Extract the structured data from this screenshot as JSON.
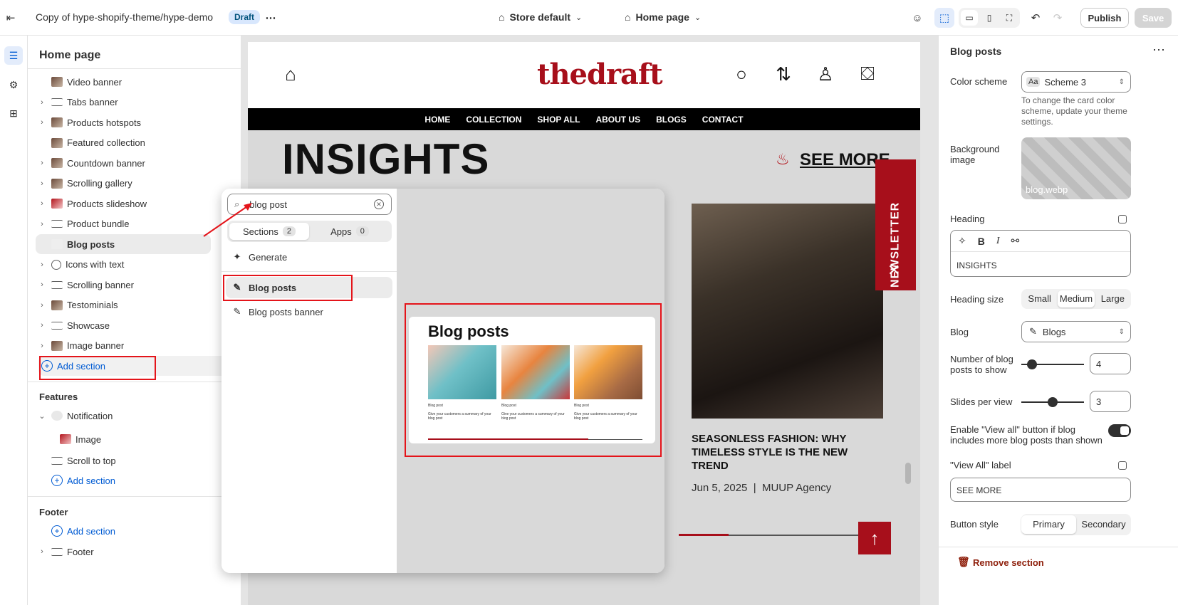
{
  "topbar": {
    "theme_name": "Copy of hype-shopify-theme/hype-demo",
    "status_badge": "Draft",
    "store_selector": "Store default",
    "page_selector": "Home page",
    "publish_label": "Publish",
    "save_label": "Save"
  },
  "left_panel": {
    "title": "Home page",
    "template_items": [
      {
        "label": "Video banner",
        "expandable": false,
        "icon": "image-thumb"
      },
      {
        "label": "Tabs banner",
        "expandable": true,
        "icon": "section-icon"
      },
      {
        "label": "Products hotspots",
        "expandable": true,
        "icon": "image-thumb"
      },
      {
        "label": "Featured collection",
        "expandable": false,
        "icon": "image-thumb"
      },
      {
        "label": "Countdown banner",
        "expandable": true,
        "icon": "image-thumb"
      },
      {
        "label": "Scrolling gallery",
        "expandable": true,
        "icon": "image-thumb"
      },
      {
        "label": "Products slideshow",
        "expandable": true,
        "icon": "image-thumb-red"
      },
      {
        "label": "Product bundle",
        "expandable": true,
        "icon": "section-icon"
      },
      {
        "label": "Blog posts",
        "expandable": false,
        "icon": "image-thumb-light",
        "selected": true
      },
      {
        "label": "Icons with text",
        "expandable": true,
        "icon": "list-icon"
      },
      {
        "label": "Scrolling banner",
        "expandable": true,
        "icon": "section-icon"
      },
      {
        "label": "Testominials",
        "expandable": true,
        "icon": "image-thumb"
      },
      {
        "label": "Showcase",
        "expandable": true,
        "icon": "section-icon"
      },
      {
        "label": "Image banner",
        "expandable": true,
        "icon": "image-thumb"
      }
    ],
    "add_section_label": "Add section",
    "features_title": "Features",
    "features_items": [
      {
        "label": "Notification",
        "expanded": true
      },
      {
        "label": "Image",
        "child": true
      },
      {
        "label": "Scroll to top"
      }
    ],
    "features_add_label": "Add section",
    "footer_title": "Footer",
    "footer_add_label": "Add section",
    "footer_items": [
      {
        "label": "Footer"
      }
    ]
  },
  "picker": {
    "search_value": "blog post",
    "tabs": [
      {
        "label": "Sections",
        "count": "2",
        "active": true
      },
      {
        "label": "Apps",
        "count": "0",
        "active": false
      }
    ],
    "generate_label": "Generate",
    "results": [
      {
        "label": "Blog posts",
        "highlighted": true
      },
      {
        "label": "Blog posts banner",
        "highlighted": false
      }
    ],
    "preview": {
      "title": "Blog posts",
      "posts": [
        {
          "label": "Blog post",
          "caption": "Give your customers a summary of your blog post"
        },
        {
          "label": "Blog post",
          "caption": "Give your customers a summary of your blog post"
        },
        {
          "label": "Blog post",
          "caption": "Give your customers a summary of your blog post"
        }
      ]
    }
  },
  "store": {
    "logo": "thedraft",
    "nav": [
      "HOME",
      "COLLECTION",
      "SHOP ALL",
      "ABOUT US",
      "BLOGS",
      "CONTACT"
    ],
    "heading": "INSIGHTS",
    "see_more": "SEE MORE",
    "newsletter": "NEWSLETTER",
    "post_title": "SEASONLESS FASHION: WHY TIMELESS STYLE IS THE NEW TREND",
    "post_date": "Jun 5, 2025",
    "post_author": "MUUP Agency",
    "brand_color": "#a70f1b"
  },
  "right_panel": {
    "title": "Blog posts",
    "color_scheme_label": "Color scheme",
    "color_scheme_value": "Scheme 3",
    "color_scheme_help": "To change the card color scheme, update your theme settings.",
    "bg_image_label": "Background image",
    "bg_image_file": "blog.webp",
    "heading_label": "Heading",
    "heading_value": "INSIGHTS",
    "heading_size_label": "Heading size",
    "heading_sizes": [
      "Small",
      "Medium",
      "Large"
    ],
    "heading_size_selected": "Medium",
    "blog_label": "Blog",
    "blog_value": "Blogs",
    "posts_count_label": "Number of blog posts to show",
    "posts_count_value": "4",
    "slides_label": "Slides per view",
    "slides_value": "3",
    "view_all_toggle_label": "Enable \"View all\" button if blog includes more blog posts than shown",
    "view_all_enabled": true,
    "view_all_label_label": "\"View All\" label",
    "view_all_label_value": "SEE MORE",
    "button_style_label": "Button style",
    "button_styles": [
      "Primary",
      "Secondary"
    ],
    "button_style_selected": "Primary",
    "remove_label": "Remove section"
  },
  "annotation_color": "#e4141a"
}
